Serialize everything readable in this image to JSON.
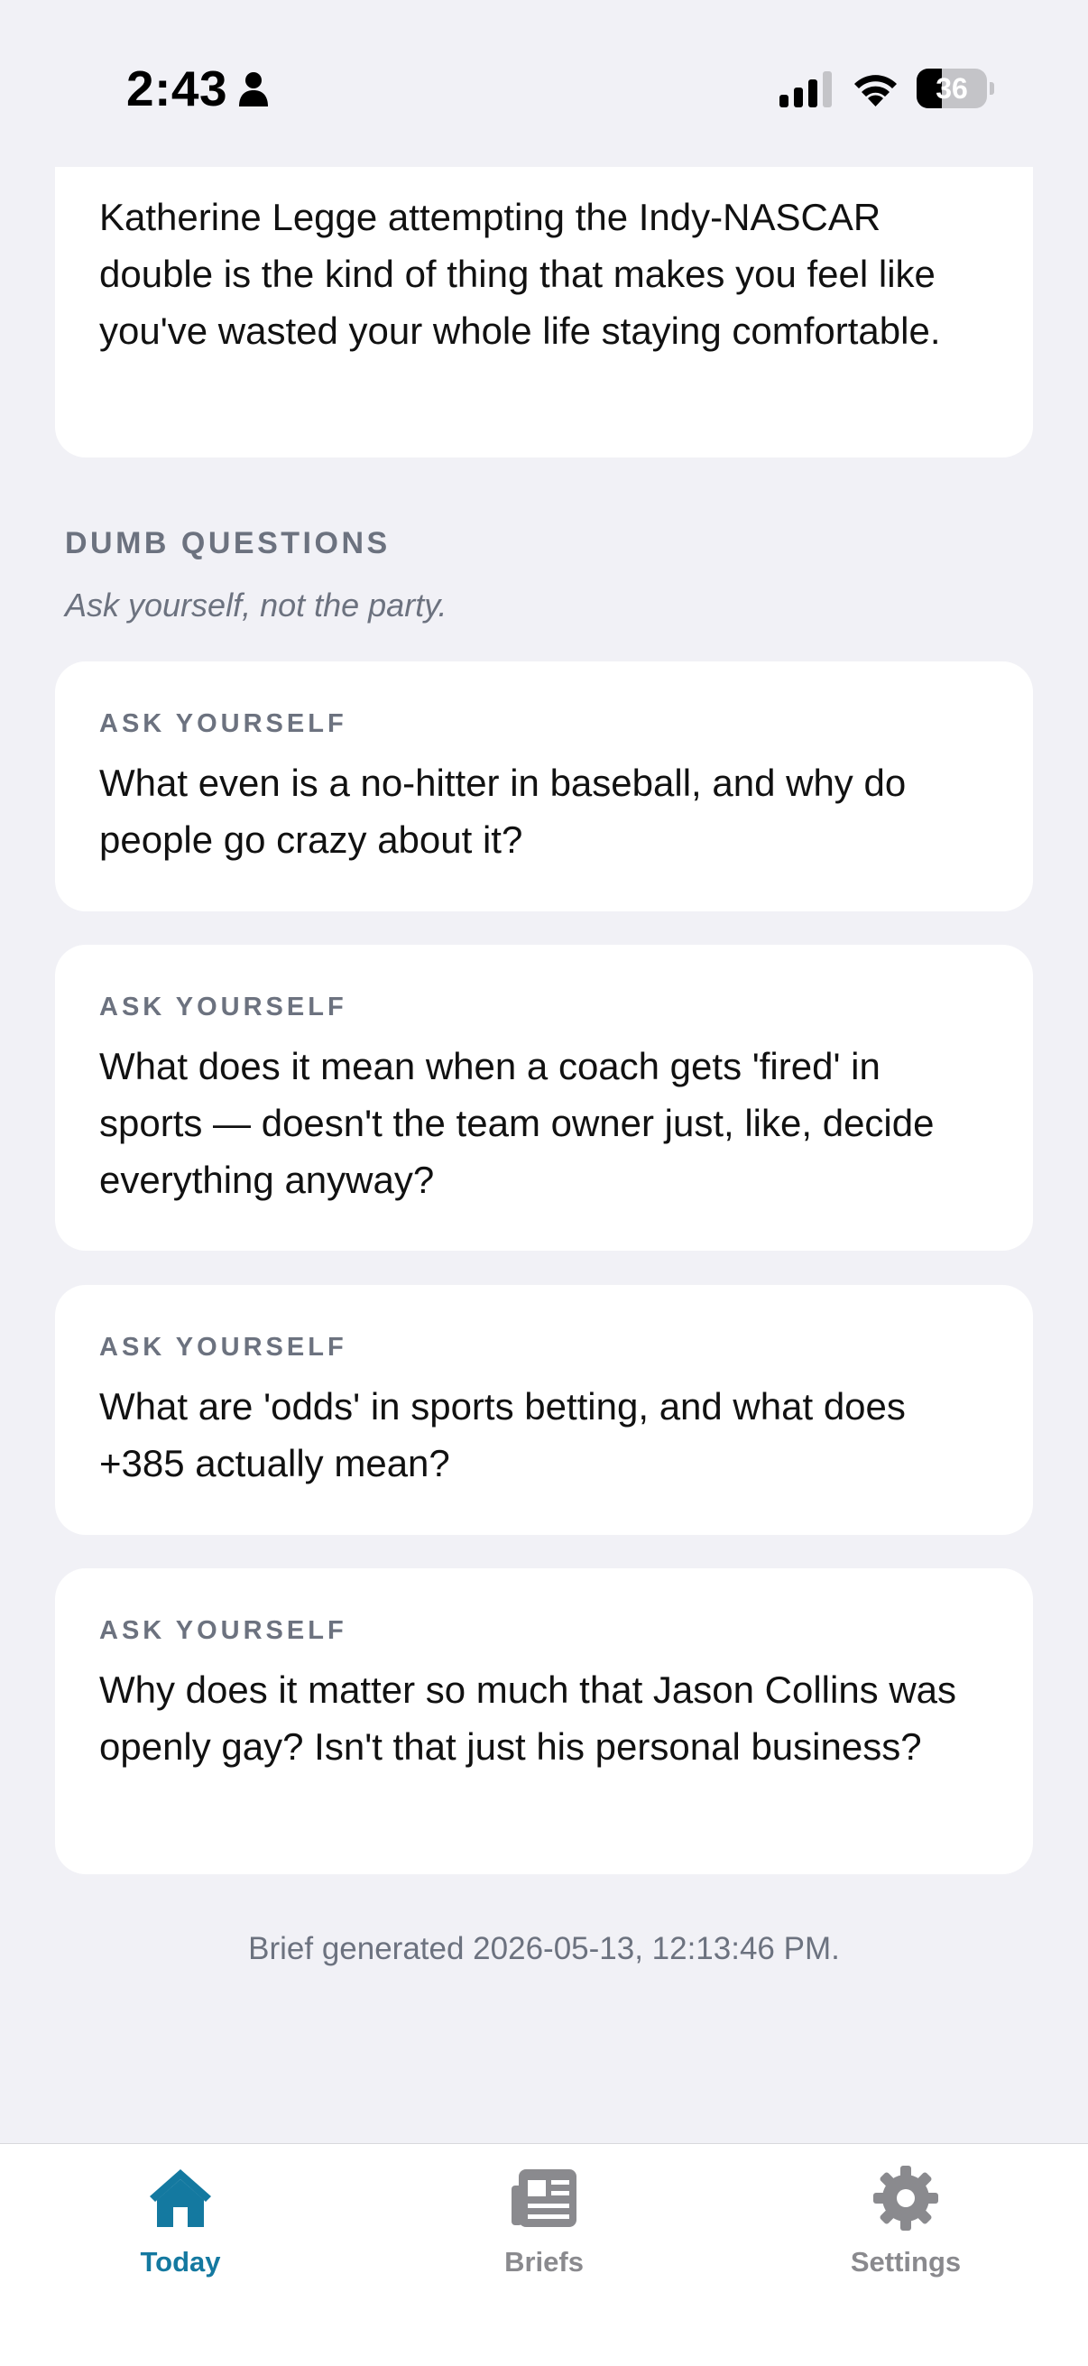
{
  "status_bar": {
    "time": "2:43",
    "battery": "36",
    "battery_level": 0.36
  },
  "top_card": {
    "text": "Katherine Legge attempting the Indy-NASCAR double is the kind of thing that makes you feel like you've wasted your whole life staying comfortable."
  },
  "dumb_questions": {
    "title": "DUMB QUESTIONS",
    "subtitle": "Ask yourself, not the party.",
    "items": [
      {
        "label": "ASK YOURSELF",
        "question": "What even is a no-hitter in baseball, and why do people go crazy about it?"
      },
      {
        "label": "ASK YOURSELF",
        "question": "What does it mean when a coach gets 'fired' in sports — doesn't the team owner just, like, decide everything anyway?"
      },
      {
        "label": "ASK YOURSELF",
        "question": "What are 'odds' in sports betting, and what does +385 actually mean?"
      },
      {
        "label": "ASK YOURSELF",
        "question": "Why does it matter so much that Jason Collins was openly gay? Isn't that just his personal business?"
      }
    ]
  },
  "footer": {
    "generated": "Brief generated 2026-05-13, 12:13:46 PM."
  },
  "tab_bar": {
    "tabs": [
      {
        "label": "Today",
        "icon": "house-icon",
        "active": true
      },
      {
        "label": "Briefs",
        "icon": "newspaper-icon",
        "active": false
      },
      {
        "label": "Settings",
        "icon": "gear-icon",
        "active": false
      }
    ]
  },
  "colors": {
    "background": "#f1f1f6",
    "card": "#ffffff",
    "accent": "#1479a0",
    "muted": "#6c727f",
    "inactive_tab": "#8a8a8e"
  }
}
